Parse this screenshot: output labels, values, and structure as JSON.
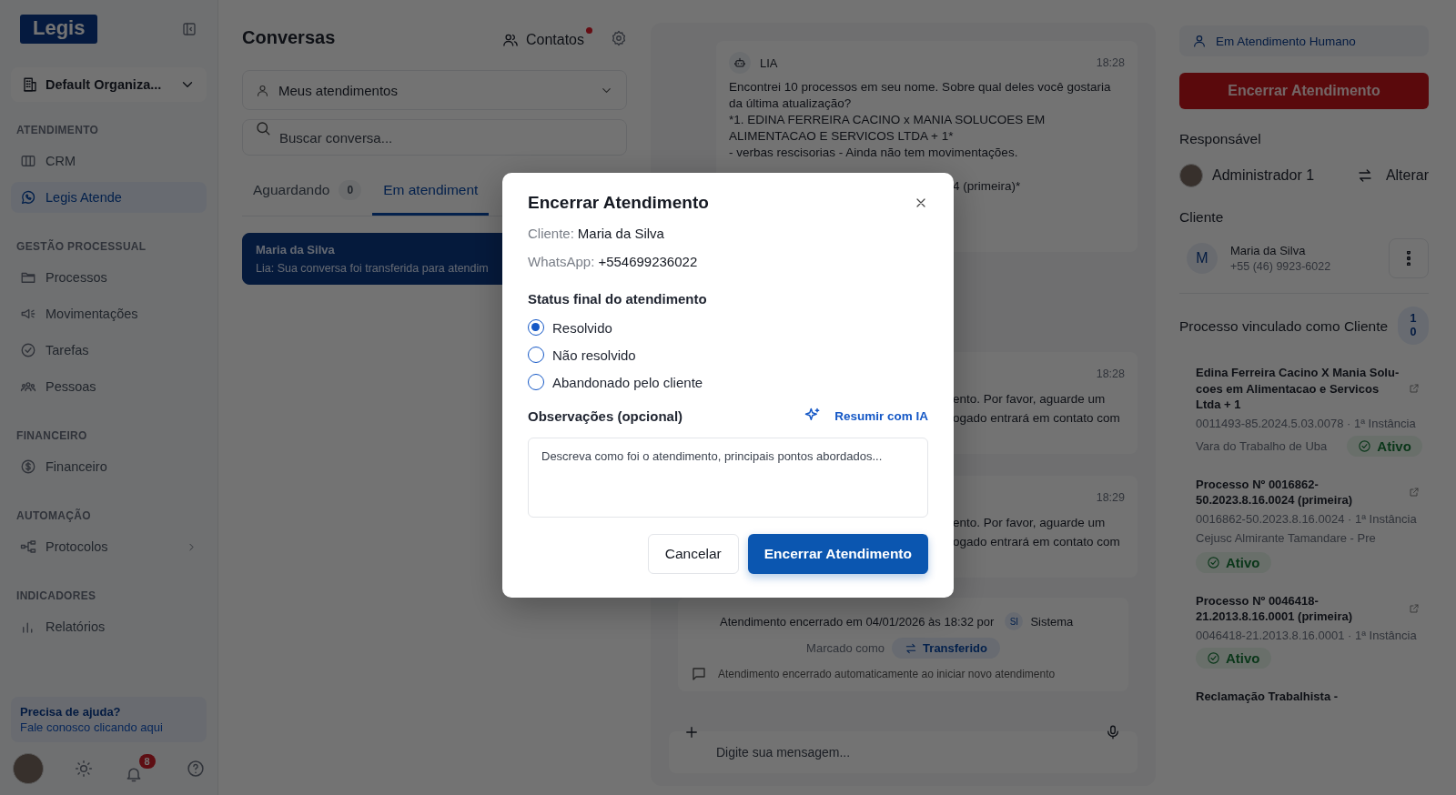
{
  "sidebar": {
    "logo": "Legis",
    "organization": "Default Organiza...",
    "sections": [
      {
        "title": "ATENDIMENTO",
        "items": [
          {
            "label": "CRM",
            "selected": false,
            "expandable": false
          },
          {
            "label": "Legis Atende",
            "selected": true,
            "expandable": false
          }
        ]
      },
      {
        "title": "GESTÃO PROCESSUAL",
        "items": [
          {
            "label": "Processos",
            "selected": false,
            "expandable": false
          },
          {
            "label": "Movimentações",
            "selected": false,
            "expandable": false
          },
          {
            "label": "Tarefas",
            "selected": false,
            "expandable": false
          },
          {
            "label": "Pessoas",
            "selected": false,
            "expandable": false
          }
        ]
      },
      {
        "title": "FINANCEIRO",
        "items": [
          {
            "label": "Financeiro",
            "selected": false,
            "expandable": false
          }
        ]
      },
      {
        "title": "AUTOMAÇÃO",
        "items": [
          {
            "label": "Protocolos",
            "selected": false,
            "expandable": true
          }
        ]
      },
      {
        "title": "INDICADORES",
        "items": [
          {
            "label": "Relatórios",
            "selected": false,
            "expandable": false
          }
        ]
      }
    ],
    "help": {
      "title": "Precisa de ajuda?",
      "link": "Fale conosco clicando aqui"
    },
    "notifications_count": "8"
  },
  "conversations": {
    "title": "Conversas",
    "contacts": {
      "label": "Contatos",
      "unread": true
    },
    "filter": "Meus atendimentos",
    "search": {
      "placeholder": "Buscar conversa..."
    },
    "tabs": [
      {
        "label": "Aguardando",
        "count": "0",
        "selected": false
      },
      {
        "label": "Em atendiment",
        "selected": true
      }
    ],
    "items": [
      {
        "name": "Maria da Silva",
        "preview": "Lia: Sua conversa foi transferida para atendim",
        "selected": true
      }
    ]
  },
  "chat": {
    "messages": [
      {
        "sender": "LIA",
        "time": "18:28",
        "text": "Encontrei 10 processos em seu nome. Sobre qual deles você gostaria da última atualização?\n*1. EDINA FERREIRA CACINO x MANIA SOLUCOES EM ALIMENTACAO E SERVICOS LTDA + 1*\n- verbas rescisorias  - Ainda não tem movimentações.",
        "tail": [
          "4 (primeira)*"
        ]
      },
      {
        "time": "18:28",
        "tail": [
          "ento. Por favor, aguarde um",
          "ogado entrará em contato com"
        ]
      },
      {
        "time": "18:29",
        "tail": [
          "ento. Por favor, aguarde um",
          "ogado entrará em contato com"
        ]
      }
    ],
    "closure": {
      "text": "Atendimento encerrado em 04/01/2026 às 18:32 por",
      "by_initials": "SI",
      "by": "Sistema",
      "marked_label": "Marcado como",
      "marked": "Transferido",
      "note": "Atendimento encerrado automaticamente ao iniciar novo atendimento"
    },
    "input": {
      "placeholder": "Digite sua mensagem..."
    }
  },
  "details": {
    "status": "Em Atendimento Humano",
    "end_button": "Encerrar Atendimento",
    "responsible_title": "Responsável",
    "responsible": "Administrador 1",
    "change": "Alterar",
    "client_title": "Cliente",
    "client": {
      "initial": "M",
      "name": "Maria da Silva",
      "phone": "+55 (46) 9923-6022"
    },
    "processes_title": "Processo vinculado como Cliente",
    "processes_count": "10",
    "processes": [
      {
        "title": "Edina Ferreira Cacino X Mania Solu-coes em Alimentacao e Servicos Ltda + 1",
        "number": "0011493-85.2024.5.03.0078 · 1ª Instância",
        "court": "Vara do Trabalho de Uba",
        "status": "Ativo"
      },
      {
        "title": "Processo Nº 0016862-50.2023.8.16.0024 (primeira)",
        "number": "0016862-50.2023.8.16.0024 · 1ª Instância",
        "court": "Cejusc Almirante Tamandare - Pre",
        "status": "Ativo"
      },
      {
        "title": "Processo Nº 0046418-21.2013.8.16.0001 (primeira)",
        "number": "0046418-21.2013.8.16.0001 · 1ª Instância",
        "status": "Ativo"
      },
      {
        "title": "Reclamação Trabalhista -"
      }
    ]
  },
  "modal": {
    "title": "Encerrar Atendimento",
    "client_label": "Cliente:",
    "client": "Maria da Silva",
    "whatsapp_label": "WhatsApp:",
    "whatsapp": "+554699236022",
    "status_title": "Status final do atendimento",
    "options": [
      {
        "label": "Resolvido",
        "selected": true
      },
      {
        "label": "Não resolvido",
        "selected": false
      },
      {
        "label": "Abandonado pelo cliente",
        "selected": false
      }
    ],
    "notes_label": "Observações (opcional)",
    "summarize": "Resumir com IA",
    "notes_placeholder": "Descreva como foi o atendimento, principais pontos abordados...",
    "cancel": "Cancelar",
    "confirm": "Encerrar Atendimento"
  }
}
